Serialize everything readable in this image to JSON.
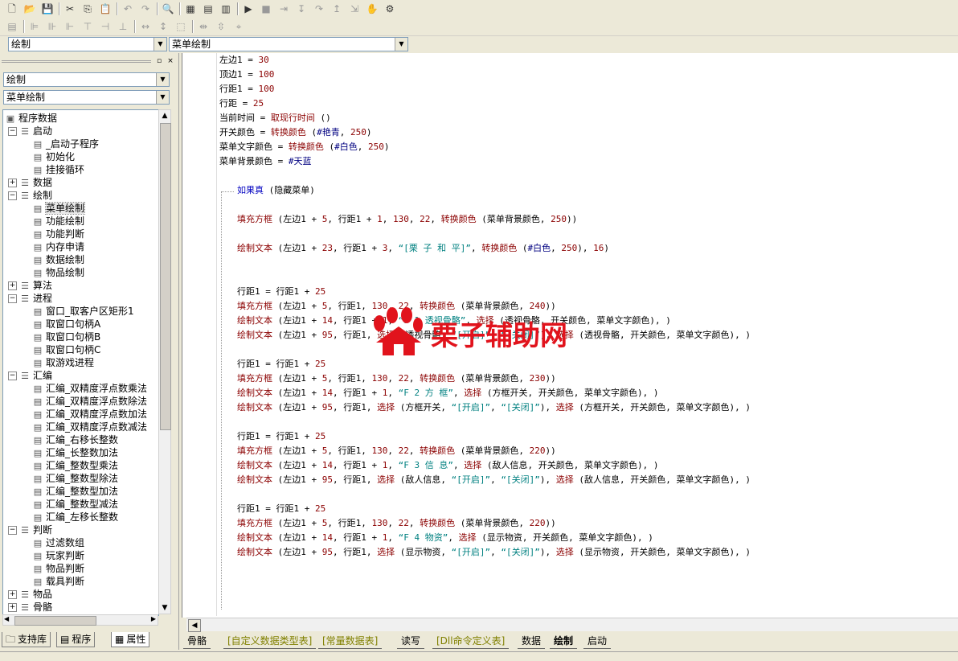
{
  "toolbar": {
    "row1_icons": [
      "new-file-icon",
      "open-file-icon",
      "save-icon",
      "cut-icon",
      "copy-icon",
      "paste-icon",
      "undo-icon",
      "redo-icon",
      "find-icon",
      "layout1-icon",
      "layout2-icon",
      "layout3-icon",
      "run-icon",
      "stop-icon",
      "step-icon",
      "step-into-icon",
      "step-over-icon",
      "step-out-icon",
      "run-to-cursor-icon",
      "hand-icon",
      "debug-icon"
    ]
  },
  "top_combos": {
    "left": "绘制",
    "right": "菜单绘制"
  },
  "left_panel": {
    "combo1": "绘制",
    "combo2": "菜单绘制",
    "tree": [
      {
        "label": "程序数据",
        "level": 0,
        "expander": "",
        "icon": "program-data-icon"
      },
      {
        "label": "启动",
        "level": 1,
        "expander": "−",
        "icon": "module-icon"
      },
      {
        "label": "_启动子程序",
        "level": 2,
        "expander": "",
        "icon": "sub-icon"
      },
      {
        "label": "初始化",
        "level": 2,
        "expander": "",
        "icon": "sub-icon"
      },
      {
        "label": "挂接循环",
        "level": 2,
        "expander": "",
        "icon": "sub-icon"
      },
      {
        "label": "数据",
        "level": 1,
        "expander": "+",
        "icon": "module-icon"
      },
      {
        "label": "绘制",
        "level": 1,
        "expander": "−",
        "icon": "module-icon"
      },
      {
        "label": "菜单绘制",
        "level": 2,
        "expander": "",
        "icon": "sub-icon",
        "selected": true
      },
      {
        "label": "功能绘制",
        "level": 2,
        "expander": "",
        "icon": "sub-icon"
      },
      {
        "label": "功能判断",
        "level": 2,
        "expander": "",
        "icon": "sub-icon"
      },
      {
        "label": "内存申请",
        "level": 2,
        "expander": "",
        "icon": "sub-icon"
      },
      {
        "label": "数据绘制",
        "level": 2,
        "expander": "",
        "icon": "sub-icon"
      },
      {
        "label": "物品绘制",
        "level": 2,
        "expander": "",
        "icon": "sub-icon"
      },
      {
        "label": "算法",
        "level": 1,
        "expander": "+",
        "icon": "module-icon"
      },
      {
        "label": "进程",
        "level": 1,
        "expander": "−",
        "icon": "module-icon"
      },
      {
        "label": "窗口_取客户区矩形1",
        "level": 2,
        "expander": "",
        "icon": "sub-icon"
      },
      {
        "label": "取窗口句柄A",
        "level": 2,
        "expander": "",
        "icon": "sub-icon"
      },
      {
        "label": "取窗口句柄B",
        "level": 2,
        "expander": "",
        "icon": "sub-icon"
      },
      {
        "label": "取窗口句柄C",
        "level": 2,
        "expander": "",
        "icon": "sub-icon"
      },
      {
        "label": "取游戏进程",
        "level": 2,
        "expander": "",
        "icon": "sub-icon"
      },
      {
        "label": "汇编",
        "level": 1,
        "expander": "−",
        "icon": "module-icon"
      },
      {
        "label": "汇编_双精度浮点数乘法",
        "level": 2,
        "expander": "",
        "icon": "sub-icon"
      },
      {
        "label": "汇编_双精度浮点数除法",
        "level": 2,
        "expander": "",
        "icon": "sub-icon"
      },
      {
        "label": "汇编_双精度浮点数加法",
        "level": 2,
        "expander": "",
        "icon": "sub-icon"
      },
      {
        "label": "汇编_双精度浮点数减法",
        "level": 2,
        "expander": "",
        "icon": "sub-icon"
      },
      {
        "label": "汇编_右移长整数",
        "level": 2,
        "expander": "",
        "icon": "sub-icon"
      },
      {
        "label": "汇编_长整数加法",
        "level": 2,
        "expander": "",
        "icon": "sub-icon"
      },
      {
        "label": "汇编_整数型乘法",
        "level": 2,
        "expander": "",
        "icon": "sub-icon"
      },
      {
        "label": "汇编_整数型除法",
        "level": 2,
        "expander": "",
        "icon": "sub-icon"
      },
      {
        "label": "汇编_整数型加法",
        "level": 2,
        "expander": "",
        "icon": "sub-icon"
      },
      {
        "label": "汇编_整数型减法",
        "level": 2,
        "expander": "",
        "icon": "sub-icon"
      },
      {
        "label": "汇编_左移长整数",
        "level": 2,
        "expander": "",
        "icon": "sub-icon"
      },
      {
        "label": "判断",
        "level": 1,
        "expander": "−",
        "icon": "module-icon"
      },
      {
        "label": "过滤数组",
        "level": 2,
        "expander": "",
        "icon": "sub-icon"
      },
      {
        "label": "玩家判断",
        "level": 2,
        "expander": "",
        "icon": "sub-icon"
      },
      {
        "label": "物品判断",
        "level": 2,
        "expander": "",
        "icon": "sub-icon"
      },
      {
        "label": "载具判断",
        "level": 2,
        "expander": "",
        "icon": "sub-icon"
      },
      {
        "label": "物品",
        "level": 1,
        "expander": "+",
        "icon": "module-icon"
      },
      {
        "label": "骨骼",
        "level": 1,
        "expander": "+",
        "icon": "module-icon"
      }
    ],
    "tabs": [
      {
        "label": "支持库",
        "icon": "library-icon"
      },
      {
        "label": "程序",
        "icon": "program-icon"
      },
      {
        "label": "属性",
        "icon": "property-icon",
        "active": true
      }
    ]
  },
  "code_lines": [
    {
      "row": 0,
      "indent": 0,
      "segs": [
        [
          "",
          "左边1 = "
        ],
        [
          "num",
          "30"
        ]
      ]
    },
    {
      "row": 1,
      "indent": 0,
      "segs": [
        [
          "",
          "顶边1 = "
        ],
        [
          "num",
          "100"
        ]
      ]
    },
    {
      "row": 2,
      "indent": 0,
      "segs": [
        [
          "",
          "行距1 = "
        ],
        [
          "num",
          "100"
        ]
      ]
    },
    {
      "row": 3,
      "indent": 0,
      "segs": [
        [
          "",
          "行距 = "
        ],
        [
          "num",
          "25"
        ]
      ]
    },
    {
      "row": 4,
      "indent": 0,
      "segs": [
        [
          "",
          "当前时间 = "
        ],
        [
          "kw",
          "取现行时间"
        ],
        [
          "",
          " ()"
        ]
      ]
    },
    {
      "row": 5,
      "indent": 0,
      "segs": [
        [
          "",
          "开关颜色 = "
        ],
        [
          "kw",
          "转换颜色"
        ],
        [
          "",
          " ("
        ],
        [
          "con",
          "#艳青"
        ],
        [
          "",
          ", "
        ],
        [
          "num",
          "250"
        ],
        [
          "",
          ")"
        ]
      ]
    },
    {
      "row": 6,
      "indent": 0,
      "segs": [
        [
          "",
          "菜单文字颜色 = "
        ],
        [
          "kw",
          "转换颜色"
        ],
        [
          "",
          " ("
        ],
        [
          "con",
          "#白色"
        ],
        [
          "",
          ", "
        ],
        [
          "num",
          "250"
        ],
        [
          "",
          ")"
        ]
      ]
    },
    {
      "row": 7,
      "indent": 0,
      "segs": [
        [
          "",
          "菜单背景颜色 = "
        ],
        [
          "con",
          "#天蓝"
        ]
      ]
    },
    {
      "row": 9,
      "indent": 1,
      "segs": [
        [
          "blue",
          "如果真"
        ],
        [
          "",
          " (隐藏菜单)"
        ]
      ]
    },
    {
      "row": 11,
      "indent": 1,
      "segs": [
        [
          "kw",
          "填充方框"
        ],
        [
          "",
          " (左边1 + "
        ],
        [
          "num",
          "5"
        ],
        [
          "",
          ", 行距1 + "
        ],
        [
          "num",
          "1"
        ],
        [
          "",
          ", "
        ],
        [
          "num",
          "130"
        ],
        [
          "",
          ", "
        ],
        [
          "num",
          "22"
        ],
        [
          "",
          ", "
        ],
        [
          "kw",
          "转换颜色"
        ],
        [
          "",
          " (菜单背景颜色, "
        ],
        [
          "num",
          "250"
        ],
        [
          "",
          "))"
        ]
      ]
    },
    {
      "row": 13,
      "indent": 1,
      "segs": [
        [
          "kw",
          "绘制文本"
        ],
        [
          "",
          " (左边1 + "
        ],
        [
          "num",
          "23"
        ],
        [
          "",
          ", 行距1 + "
        ],
        [
          "num",
          "3"
        ],
        [
          "",
          ", "
        ],
        [
          "str",
          "“[栗 子 和 平]”"
        ],
        [
          "",
          ", "
        ],
        [
          "kw",
          "转换颜色"
        ],
        [
          "",
          " ("
        ],
        [
          "con",
          "#白色"
        ],
        [
          "",
          ", "
        ],
        [
          "num",
          "250"
        ],
        [
          "",
          "), "
        ],
        [
          "num",
          "16"
        ],
        [
          "",
          ")"
        ]
      ]
    },
    {
      "row": 16,
      "indent": 1,
      "segs": [
        [
          "",
          "行距1 = 行距1 + "
        ],
        [
          "num",
          "25"
        ]
      ]
    },
    {
      "row": 17,
      "indent": 1,
      "segs": [
        [
          "kw",
          "填充方框"
        ],
        [
          "",
          " (左边1 + "
        ],
        [
          "num",
          "5"
        ],
        [
          "",
          ", 行距1, "
        ],
        [
          "num",
          "130"
        ],
        [
          "",
          ", "
        ],
        [
          "num",
          "22"
        ],
        [
          "",
          ", "
        ],
        [
          "kw",
          "转换颜色"
        ],
        [
          "",
          " (菜单背景颜色, "
        ],
        [
          "num",
          "240"
        ],
        [
          "",
          "))"
        ]
      ]
    },
    {
      "row": 18,
      "indent": 1,
      "segs": [
        [
          "kw",
          "绘制文本"
        ],
        [
          "",
          " (左边1 + "
        ],
        [
          "num",
          "14"
        ],
        [
          "",
          ", 行距1 + "
        ],
        [
          "num",
          "1"
        ],
        [
          "",
          ", "
        ],
        [
          "str",
          "“F 1 透视骨骼”"
        ],
        [
          "",
          ", "
        ],
        [
          "kw",
          "选择"
        ],
        [
          "",
          " (透视骨骼, 开关颜色, 菜单文字颜色), )"
        ]
      ]
    },
    {
      "row": 19,
      "indent": 1,
      "segs": [
        [
          "kw",
          "绘制文本"
        ],
        [
          "",
          " (左边1 + "
        ],
        [
          "num",
          "95"
        ],
        [
          "",
          ", 行距1, "
        ],
        [
          "kw",
          "选择"
        ],
        [
          "",
          " (透视骨骼, "
        ],
        [
          "str",
          "“[开启]”"
        ],
        [
          "",
          ", "
        ],
        [
          "str",
          "“[关闭]”"
        ],
        [
          "",
          "), "
        ],
        [
          "kw",
          "选择"
        ],
        [
          "",
          " (透视骨骼, 开关颜色, 菜单文字颜色), )"
        ]
      ]
    },
    {
      "row": 21,
      "indent": 1,
      "segs": [
        [
          "",
          "行距1 = 行距1 + "
        ],
        [
          "num",
          "25"
        ]
      ]
    },
    {
      "row": 22,
      "indent": 1,
      "segs": [
        [
          "kw",
          "填充方框"
        ],
        [
          "",
          " (左边1 + "
        ],
        [
          "num",
          "5"
        ],
        [
          "",
          ", 行距1, "
        ],
        [
          "num",
          "130"
        ],
        [
          "",
          ", "
        ],
        [
          "num",
          "22"
        ],
        [
          "",
          ", "
        ],
        [
          "kw",
          "转换颜色"
        ],
        [
          "",
          " (菜单背景颜色, "
        ],
        [
          "num",
          "230"
        ],
        [
          "",
          "))"
        ]
      ]
    },
    {
      "row": 23,
      "indent": 1,
      "segs": [
        [
          "kw",
          "绘制文本"
        ],
        [
          "",
          " (左边1 + "
        ],
        [
          "num",
          "14"
        ],
        [
          "",
          ", 行距1 + "
        ],
        [
          "num",
          "1"
        ],
        [
          "",
          ", "
        ],
        [
          "str",
          "“F 2 方 框”"
        ],
        [
          "",
          ", "
        ],
        [
          "kw",
          "选择"
        ],
        [
          "",
          " (方框开关, 开关颜色, 菜单文字颜色), )"
        ]
      ]
    },
    {
      "row": 24,
      "indent": 1,
      "segs": [
        [
          "kw",
          "绘制文本"
        ],
        [
          "",
          " (左边1 + "
        ],
        [
          "num",
          "95"
        ],
        [
          "",
          ", 行距1, "
        ],
        [
          "kw",
          "选择"
        ],
        [
          "",
          " (方框开关, "
        ],
        [
          "str",
          "“[开启]”"
        ],
        [
          "",
          ", "
        ],
        [
          "str",
          "“[关闭]”"
        ],
        [
          "",
          "), "
        ],
        [
          "kw",
          "选择"
        ],
        [
          "",
          " (方框开关, 开关颜色, 菜单文字颜色), )"
        ]
      ]
    },
    {
      "row": 26,
      "indent": 1,
      "segs": [
        [
          "",
          "行距1 = 行距1 + "
        ],
        [
          "num",
          "25"
        ]
      ]
    },
    {
      "row": 27,
      "indent": 1,
      "segs": [
        [
          "kw",
          "填充方框"
        ],
        [
          "",
          " (左边1 + "
        ],
        [
          "num",
          "5"
        ],
        [
          "",
          ", 行距1, "
        ],
        [
          "num",
          "130"
        ],
        [
          "",
          ", "
        ],
        [
          "num",
          "22"
        ],
        [
          "",
          ", "
        ],
        [
          "kw",
          "转换颜色"
        ],
        [
          "",
          " (菜单背景颜色, "
        ],
        [
          "num",
          "220"
        ],
        [
          "",
          "))"
        ]
      ]
    },
    {
      "row": 28,
      "indent": 1,
      "segs": [
        [
          "kw",
          "绘制文本"
        ],
        [
          "",
          " (左边1 + "
        ],
        [
          "num",
          "14"
        ],
        [
          "",
          ", 行距1 + "
        ],
        [
          "num",
          "1"
        ],
        [
          "",
          ", "
        ],
        [
          "str",
          "“F 3 信 息”"
        ],
        [
          "",
          ", "
        ],
        [
          "kw",
          "选择"
        ],
        [
          "",
          " (敌人信息, 开关颜色, 菜单文字颜色), )"
        ]
      ]
    },
    {
      "row": 29,
      "indent": 1,
      "segs": [
        [
          "kw",
          "绘制文本"
        ],
        [
          "",
          " (左边1 + "
        ],
        [
          "num",
          "95"
        ],
        [
          "",
          ", 行距1, "
        ],
        [
          "kw",
          "选择"
        ],
        [
          "",
          " (敌人信息, "
        ],
        [
          "str",
          "“[开启]”"
        ],
        [
          "",
          ", "
        ],
        [
          "str",
          "“[关闭]”"
        ],
        [
          "",
          "), "
        ],
        [
          "kw",
          "选择"
        ],
        [
          "",
          " (敌人信息, 开关颜色, 菜单文字颜色), )"
        ]
      ]
    },
    {
      "row": 31,
      "indent": 1,
      "segs": [
        [
          "",
          "行距1 = 行距1 + "
        ],
        [
          "num",
          "25"
        ]
      ]
    },
    {
      "row": 32,
      "indent": 1,
      "segs": [
        [
          "kw",
          "填充方框"
        ],
        [
          "",
          " (左边1 + "
        ],
        [
          "num",
          "5"
        ],
        [
          "",
          ", 行距1, "
        ],
        [
          "num",
          "130"
        ],
        [
          "",
          ", "
        ],
        [
          "num",
          "22"
        ],
        [
          "",
          ", "
        ],
        [
          "kw",
          "转换颜色"
        ],
        [
          "",
          " (菜单背景颜色, "
        ],
        [
          "num",
          "220"
        ],
        [
          "",
          "))"
        ]
      ]
    },
    {
      "row": 33,
      "indent": 1,
      "segs": [
        [
          "kw",
          "绘制文本"
        ],
        [
          "",
          " (左边1 + "
        ],
        [
          "num",
          "14"
        ],
        [
          "",
          ", 行距1 + "
        ],
        [
          "num",
          "1"
        ],
        [
          "",
          ", "
        ],
        [
          "str",
          "“F 4 物资”"
        ],
        [
          "",
          ", "
        ],
        [
          "kw",
          "选择"
        ],
        [
          "",
          " (显示物资, 开关颜色, 菜单文字颜色), )"
        ]
      ]
    },
    {
      "row": 34,
      "indent": 1,
      "segs": [
        [
          "kw",
          "绘制文本"
        ],
        [
          "",
          " (左边1 + "
        ],
        [
          "num",
          "95"
        ],
        [
          "",
          ", 行距1, "
        ],
        [
          "kw",
          "选择"
        ],
        [
          "",
          " (显示物资, "
        ],
        [
          "str",
          "“[开启]”"
        ],
        [
          "",
          ", "
        ],
        [
          "str",
          "“[关闭]”"
        ],
        [
          "",
          "), "
        ],
        [
          "kw",
          "选择"
        ],
        [
          "",
          " (显示物资, 开关颜色, 菜单文字颜色), )"
        ]
      ]
    }
  ],
  "editor_tabs": [
    {
      "label": "骨骼"
    },
    {
      "label": "[自定义数据类型表]",
      "olive": true
    },
    {
      "label": "[常量数据表]",
      "olive": true
    },
    {
      "label": "读写"
    },
    {
      "label": "[Dll命令定义表]",
      "olive": true
    },
    {
      "label": "数据"
    },
    {
      "label": "绘制",
      "active": true
    },
    {
      "label": "启动"
    }
  ],
  "watermark": {
    "text": "栗子辅助网",
    "color": "#e1131c"
  }
}
